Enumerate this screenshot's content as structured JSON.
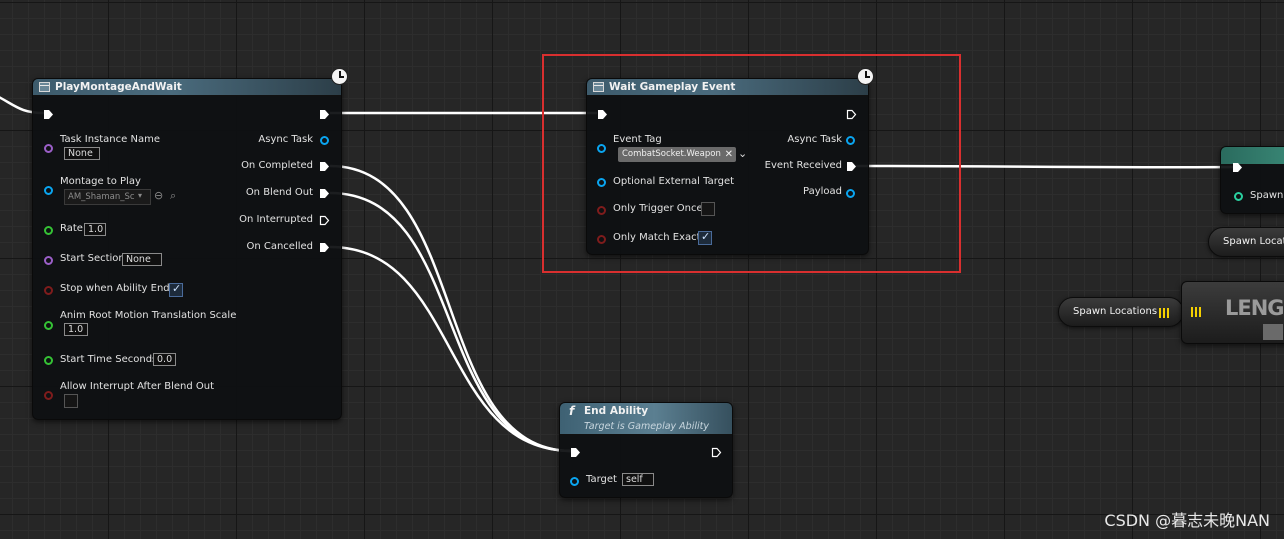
{
  "play_montage": {
    "title": "PlayMontageAndWait",
    "inputs": {
      "task_instance_name": {
        "label": "Task Instance Name",
        "value": "None"
      },
      "montage_to_play": {
        "label": "Montage to Play",
        "value": "AM_Shaman_Sc"
      },
      "rate": {
        "label": "Rate",
        "value": "1.0"
      },
      "start_section": {
        "label": "Start Section",
        "value": "None"
      },
      "stop_when_ability_ends": {
        "label": "Stop when Ability Ends",
        "checked": true
      },
      "anim_root_motion": {
        "label": "Anim Root Motion Translation Scale",
        "value": "1.0"
      },
      "start_time_seconds": {
        "label": "Start Time Seconds",
        "value": "0.0"
      },
      "allow_interrupt": {
        "label": "Allow Interrupt After Blend Out",
        "checked": false
      }
    },
    "outputs": {
      "async_task": "Async Task",
      "on_completed": "On Completed",
      "on_blend_out": "On Blend Out",
      "on_interrupted": "On Interrupted",
      "on_cancelled": "On Cancelled"
    }
  },
  "wait_gameplay_event": {
    "title": "Wait Gameplay Event",
    "inputs": {
      "event_tag": {
        "label": "Event Tag",
        "value": "CombatSocket.Weapon"
      },
      "optional_external_target": {
        "label": "Optional External Target"
      },
      "only_trigger_once": {
        "label": "Only Trigger Once",
        "checked": false
      },
      "only_match_exact": {
        "label": "Only Match Exact",
        "checked": true
      }
    },
    "outputs": {
      "async_task": "Async Task",
      "event_received": "Event Received",
      "payload": "Payload"
    }
  },
  "end_ability": {
    "title": "End Ability",
    "subtitle": "Target is Gameplay Ability",
    "target_label": "Target",
    "target_value": "self"
  },
  "right_nodes": {
    "spawn_label": "Spawn",
    "spawn_locat": "Spawn Locat",
    "spawn_locations": "Spawn Locations",
    "length": "LENG"
  },
  "watermark": "CSDN @暮志未晚NAN",
  "colors": {
    "highlight_box": "#d92f2f",
    "exec_wire": "#ffffff",
    "object_pin": "#0aa5f0",
    "name_pin": "#9b5fc8",
    "float_pin": "#35c235",
    "bool_pin": "#7f1c1c",
    "array_pin": "#f5d000"
  }
}
